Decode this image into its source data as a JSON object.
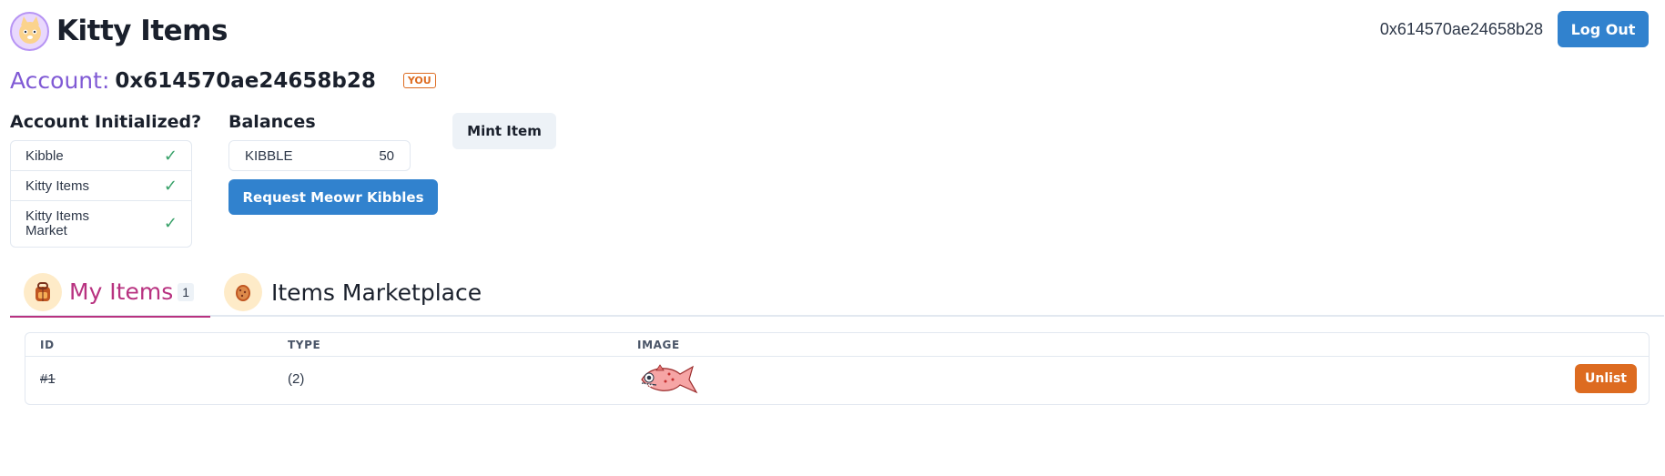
{
  "header": {
    "app_title": "Kitty Items",
    "user_address": "0x614570ae24658b28",
    "logout_label": "Log Out"
  },
  "account": {
    "label": "Account:",
    "address": "0x614570ae24658b28",
    "badge": "YOU"
  },
  "initialized": {
    "title": "Account Initialized?",
    "items": [
      {
        "label": "Kibble",
        "status": "check"
      },
      {
        "label": "Kitty Items",
        "status": "check"
      },
      {
        "label": "Kitty Items Market",
        "status": "check"
      }
    ]
  },
  "balances": {
    "title": "Balances",
    "token": "KIBBLE",
    "amount": "50",
    "request_label": "Request Meowr Kibbles"
  },
  "mint": {
    "label": "Mint Item"
  },
  "tabs": [
    {
      "label": "My Items",
      "count": "1",
      "active": true,
      "icon": "backpack-icon"
    },
    {
      "label": "Items Marketplace",
      "active": false,
      "icon": "cookie-icon"
    }
  ],
  "table": {
    "headers": [
      "ID",
      "TYPE",
      "IMAGE"
    ],
    "rows": [
      {
        "id": "#1",
        "type": "(2)",
        "image": "fish-icon",
        "action": "Unlist"
      }
    ]
  },
  "colors": {
    "primary": "#3182ce",
    "accent_purple": "#805ad5",
    "tab_active": "#b83280",
    "badge_orange": "#dd6b20",
    "check_green": "#38a169"
  }
}
